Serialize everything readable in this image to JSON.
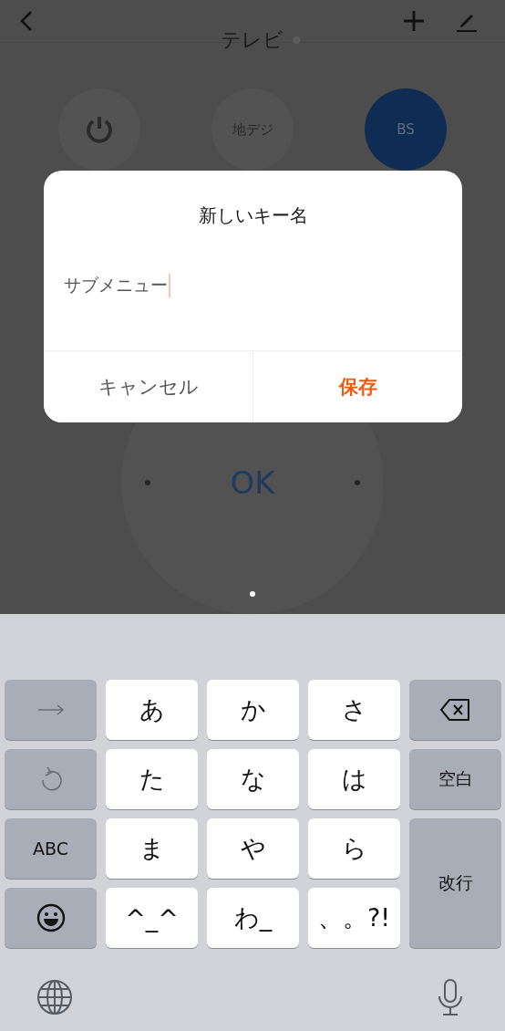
{
  "header": {
    "title": "テレビ"
  },
  "remote_buttons": [
    {
      "kind": "power"
    },
    {
      "kind": "text",
      "label": "地デジ"
    },
    {
      "kind": "accent",
      "label": "BS"
    }
  ],
  "dpad": {
    "center_label": "OK"
  },
  "dialog": {
    "title": "新しいキー名",
    "input": {
      "value": "サブメニュー"
    },
    "buttons": [
      {
        "label": "キャンセル",
        "kind": "cancel"
      },
      {
        "label": "保存",
        "kind": "primary"
      }
    ]
  },
  "keyboard": {
    "keys": [
      {
        "kind": "arrow"
      },
      {
        "kind": "char",
        "label": "あ"
      },
      {
        "kind": "char",
        "label": "か"
      },
      {
        "kind": "char",
        "label": "さ"
      },
      {
        "kind": "backspace"
      },
      {
        "kind": "undo"
      },
      {
        "kind": "char",
        "label": "た"
      },
      {
        "kind": "char",
        "label": "な"
      },
      {
        "kind": "char",
        "label": "は"
      },
      {
        "kind": "function",
        "label": "空白"
      },
      {
        "kind": "function",
        "label": "ABC"
      },
      {
        "kind": "char",
        "label": "ま"
      },
      {
        "kind": "char",
        "label": "や"
      },
      {
        "kind": "char",
        "label": "ら"
      },
      {
        "kind": "enter",
        "label": "改行"
      },
      {
        "kind": "emoji"
      },
      {
        "kind": "char",
        "label": "^_^"
      },
      {
        "kind": "char",
        "label": "わ_"
      },
      {
        "kind": "char",
        "label": "、。?!"
      }
    ]
  }
}
